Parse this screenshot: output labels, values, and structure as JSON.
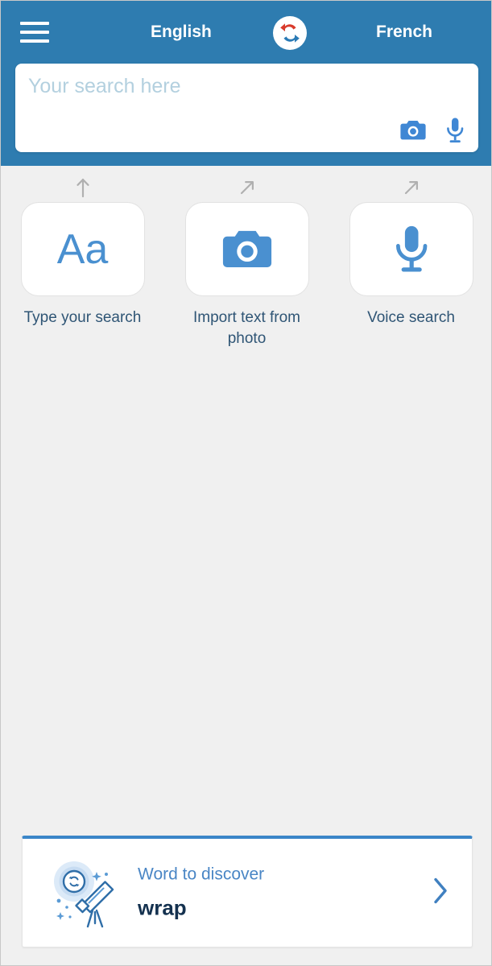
{
  "header": {
    "menu_icon": "hamburger-menu-icon",
    "source_language": "English",
    "target_language": "French",
    "swap_icon": "swap-languages-icon"
  },
  "search": {
    "value": "",
    "placeholder": "Your search here",
    "camera_icon": "camera-icon",
    "microphone_icon": "microphone-icon"
  },
  "actions": [
    {
      "glyph": "Aa",
      "icon": "text-aa-icon",
      "label": "Type your search",
      "hint_arrow": "arrow-up-icon"
    },
    {
      "glyph": "",
      "icon": "camera-icon",
      "label": "Import text from photo",
      "hint_arrow": "arrow-up-right-icon"
    },
    {
      "glyph": "",
      "icon": "microphone-icon",
      "label": "Voice search",
      "hint_arrow": "arrow-up-right-icon"
    }
  ],
  "word_card": {
    "kicker": "Word to discover",
    "term": "wrap",
    "illustration_icon": "telescope-icon",
    "chevron_icon": "chevron-right-icon"
  },
  "colors": {
    "header_blue": "#2e7cb0",
    "accent_blue": "#3b86c8",
    "icon_blue": "#4a90d0",
    "label_navy": "#2f5575",
    "term_navy": "#14314f",
    "placeholder_blue": "#b3d0df",
    "page_background": "#f0f0f0",
    "swap_arrow_red": "#d93a2b",
    "swap_arrow_blue": "#2a7ab5"
  }
}
